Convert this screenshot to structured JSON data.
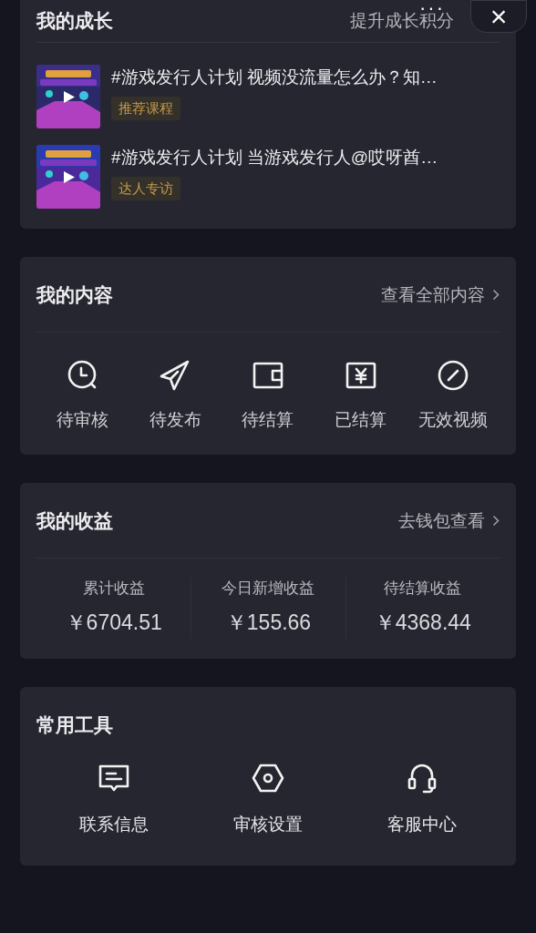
{
  "top_actions": {
    "more": "···",
    "close": "×"
  },
  "growth": {
    "title": "我的成长",
    "link": "提升成长积分",
    "items": [
      {
        "title": "#游戏发行人计划 视频没流量怎么办？知…",
        "tag": "推荐课程"
      },
      {
        "title": "#游戏发行人计划 当游戏发行人@哎呀酋…",
        "tag": "达人专访"
      }
    ]
  },
  "content": {
    "title": "我的内容",
    "link": "查看全部内容",
    "actions": [
      {
        "kind": "clock",
        "label": "待审核"
      },
      {
        "kind": "send",
        "label": "待发布"
      },
      {
        "kind": "wallet",
        "label": "待结算"
      },
      {
        "kind": "yen",
        "label": "已结算"
      },
      {
        "kind": "invalid",
        "label": "无效视频"
      }
    ]
  },
  "earnings": {
    "title": "我的收益",
    "link": "去钱包查看",
    "stats": [
      {
        "label": "累计收益",
        "value": "￥6704.51"
      },
      {
        "label": "今日新增收益",
        "value": "￥155.66"
      },
      {
        "label": "待结算收益",
        "value": "￥4368.44"
      }
    ]
  },
  "tools": {
    "title": "常用工具",
    "items": [
      {
        "kind": "message",
        "label": "联系信息"
      },
      {
        "kind": "hexagon",
        "label": "审核设置"
      },
      {
        "kind": "headset",
        "label": "客服中心"
      }
    ]
  }
}
